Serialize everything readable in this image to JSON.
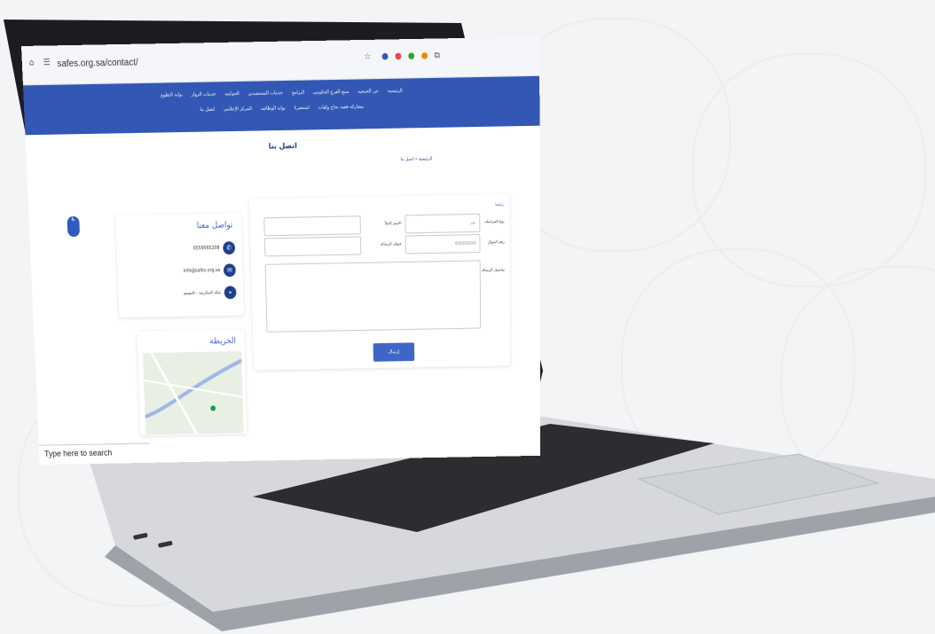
{
  "browser": {
    "url": "safes.org.sa/contact/"
  },
  "nav": {
    "row1": [
      "الرئيسية",
      "عن الجمعية",
      "منبع الفرع الحكومي",
      "البرامج",
      "خدمات المستفيدين",
      "الحوكمة",
      "خدمات الزوار",
      "بوابة التطوع"
    ],
    "row2": [
      "مشاركة قصة نجاح ولقات",
      "استشرنا",
      "بوابة الوظائف",
      "المركز الإعلامي",
      "اتصل بنا"
    ]
  },
  "page": {
    "title": "اتصل بنا",
    "breadcrumb": "الرئيسية » اتصل بنا"
  },
  "form": {
    "heading": "راسلنا",
    "type_label": "نوع المراسلة",
    "type_value": "عام",
    "name_label": "الاسم كاملاً",
    "phone_label": "رقم الجوال",
    "phone_placeholder": "05XXXXXXX",
    "subject_label": "عنوان الرسالة",
    "details_label": "تفاصيل الرسالة",
    "send_label": "إرسال"
  },
  "contact": {
    "heading": "تواصل معنا",
    "phone": "0559565208",
    "email": "info@safes.org.sa",
    "address": "مكة المكرمة - النسيم"
  },
  "map": {
    "heading": "الخريطة"
  },
  "taskbar": {
    "search_placeholder": "Type here to search"
  },
  "colors": {
    "brand": "#3257b5",
    "dark": "#1f3f8e"
  }
}
